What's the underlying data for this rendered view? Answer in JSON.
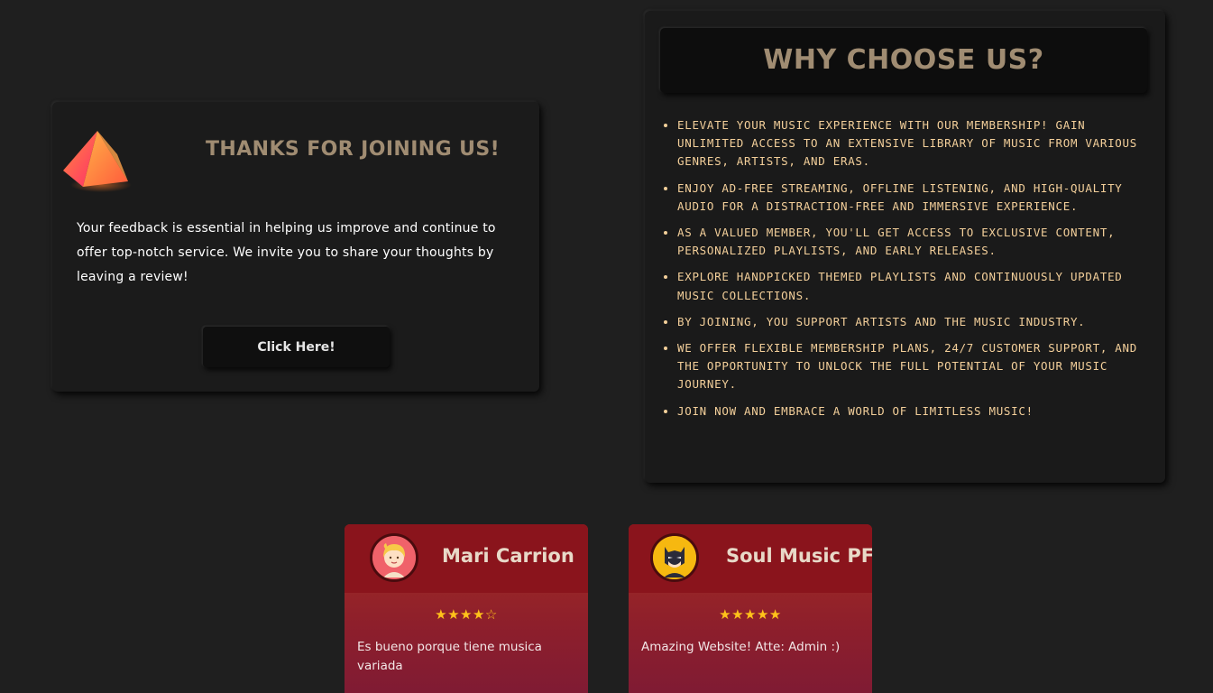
{
  "thanks": {
    "title": "THANKS FOR JOINING US!",
    "text": "Your feedback is essential in helping us improve and continue to offer top-notch service. We invite you to share your thoughts by leaving a review!",
    "button_label": "Click Here!",
    "icon": "pyramid-gem-icon"
  },
  "why": {
    "title": "WHY CHOOSE US?",
    "items": [
      "Elevate your music experience with our membership! Gain unlimited access to an extensive library of music from various genres, artists, and eras.",
      "Enjoy ad-free streaming, offline listening, and high-quality audio for a distraction-free and immersive experience.",
      "As a valued member, you'll get access to exclusive content, personalized playlists, and early releases.",
      "Explore handpicked themed playlists and continuously updated music collections.",
      "By joining, you support artists and the music industry.",
      "We offer flexible membership plans, 24/7 customer support, and the opportunity to unlock the full potential of your music journey.",
      "Join now and embrace a world of limitless music!"
    ]
  },
  "reviews": [
    {
      "name": "Mari Carrion",
      "stars": "★★★★☆",
      "rating": 4,
      "text": "Es bueno porque tiene musica variada",
      "avatar": "blonde-girl-avatar-icon"
    },
    {
      "name": "Soul Music PF",
      "stars": "★★★★★",
      "rating": 5,
      "text": "Amazing Website! Atte: Admin :)",
      "avatar": "batman-avatar-icon"
    }
  ],
  "colors": {
    "background": "#1f1f1f",
    "card": "#1b1b1b",
    "title_gold": "#a08c72",
    "list_text": "#f3cf9a",
    "review_header": "#8a141c",
    "star": "#ffc21a"
  }
}
